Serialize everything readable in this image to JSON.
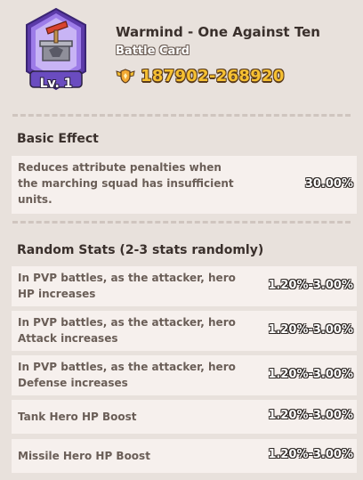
{
  "card": {
    "level_label": "Lv. 1",
    "title": "Warmind - One Against Ten",
    "subtitle": "Battle Card",
    "power_icon": "winged-shield-icon",
    "power_range": "187902-268920"
  },
  "basic_effect": {
    "heading": "Basic Effect",
    "rows": [
      {
        "label": "Reduces attribute penalties when the marching squad has insufficient units.",
        "value": "30.00%"
      }
    ]
  },
  "random_stats": {
    "heading": "Random Stats (2-3 stats randomly)",
    "rows": [
      {
        "label": "In PVP battles, as the attacker, hero HP increases",
        "value": "1.20%-3.00%"
      },
      {
        "label": "In PVP battles, as the attacker, hero Attack increases",
        "value": "1.20%-3.00%"
      },
      {
        "label": "In PVP battles, as the attacker, hero Defense increases",
        "value": "1.20%-3.00%"
      },
      {
        "label": "Tank Hero HP Boost",
        "value": "1.20%-3.00%"
      },
      {
        "label": "Missile Hero HP Boost",
        "value": "1.20%-3.00%"
      }
    ]
  },
  "colors": {
    "background": "#e8e1dc",
    "row_background": "#f6f0ed",
    "power_gold": "#f6c032",
    "card_frame": "#7b55c8"
  }
}
